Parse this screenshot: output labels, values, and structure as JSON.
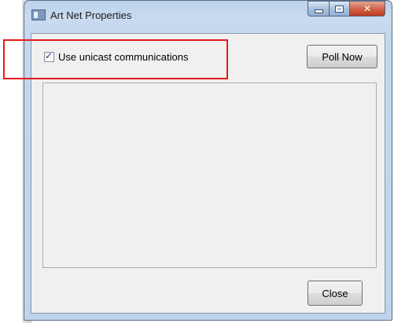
{
  "window": {
    "title": "Art Net Properties"
  },
  "options": {
    "unicast_label": "Use unicast communications",
    "unicast_checked": true
  },
  "buttons": {
    "poll_now": "Poll Now",
    "close": "Close"
  },
  "colors": {
    "highlight": "#e31b1b",
    "close_button": "#c1391d"
  }
}
